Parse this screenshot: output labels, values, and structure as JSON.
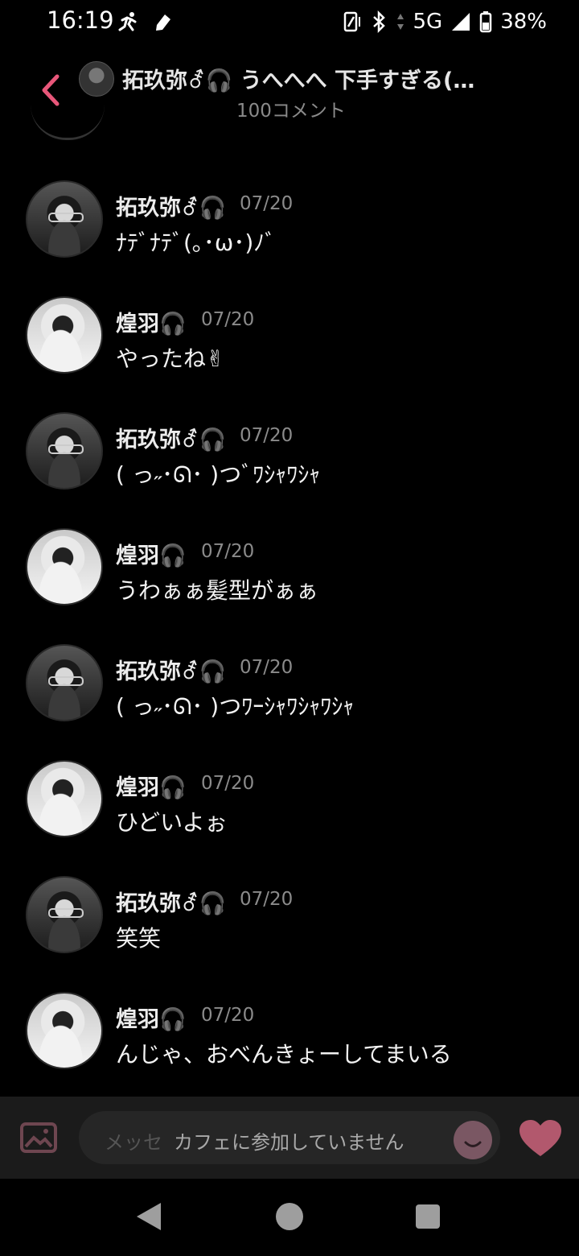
{
  "status_bar": {
    "time": "16:19",
    "network": "5G",
    "battery": "38%",
    "icons": [
      "running-person-icon",
      "pencil-tag-icon",
      "vibrate-icon",
      "bluetooth-icon",
      "data-arrows-icon",
      "signal-icon",
      "battery-icon"
    ]
  },
  "header": {
    "title": "拓玖弥⚦🎧 うへへへ 下手すぎる(…",
    "subtitle": "100コメント"
  },
  "messages": [
    {
      "author": "拓玖弥⚦🎧",
      "date": "07/20",
      "text": "ﾅﾃﾞﾅﾃﾞ(｡･ω･)ﾉﾞ",
      "avatar": "a"
    },
    {
      "author": "煌羽🎧",
      "date": "07/20",
      "text": "やったね✌",
      "avatar": "b"
    },
    {
      "author": "拓玖弥⚦🎧",
      "date": "07/20",
      "text": "( っ˶･ᘏ･ )つﾞﾜｼｬﾜｼｬ",
      "avatar": "a"
    },
    {
      "author": "煌羽🎧",
      "date": "07/20",
      "text": "うわぁぁ髪型がぁぁ",
      "avatar": "b"
    },
    {
      "author": "拓玖弥⚦🎧",
      "date": "07/20",
      "text": "( っ˶･ᘏ･ )つﾜｰｼｬﾜｼｬﾜｼｬ",
      "avatar": "a"
    },
    {
      "author": "煌羽🎧",
      "date": "07/20",
      "text": "ひどいよぉ",
      "avatar": "b"
    },
    {
      "author": "拓玖弥⚦🎧",
      "date": "07/20",
      "text": "笑笑",
      "avatar": "a"
    },
    {
      "author": "煌羽🎧",
      "date": "07/20",
      "text": "んじゃ、おべんきょーしてまいる",
      "avatar": "b"
    }
  ],
  "input": {
    "placeholder": "メッセ",
    "notice": "カフェに参加していません"
  },
  "colors": {
    "accent": "#e8577a",
    "heart": "#b2586d",
    "background": "#000000"
  }
}
